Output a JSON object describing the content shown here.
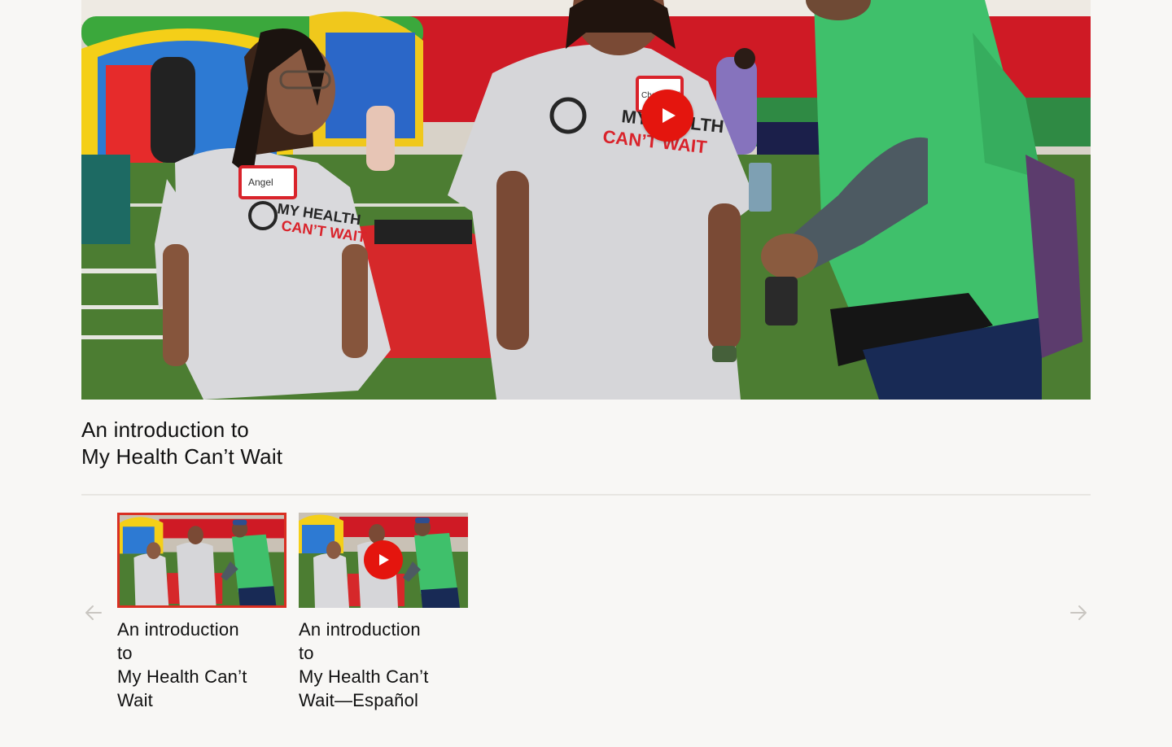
{
  "player": {
    "main_title": [
      "An introduction to",
      "My Health Can’t Wait"
    ],
    "scene": {
      "shirt_text": [
        "MY HEALTH",
        "CAN’T WAIT"
      ],
      "badge_text": [
        "Angel",
        "Chadwood"
      ]
    }
  },
  "carousel": {
    "prev_icon": "arrow-left-icon",
    "next_icon": "arrow-right-icon",
    "items": [
      {
        "title": [
          "An introduction",
          "to",
          "My Health Can’t",
          "Wait"
        ],
        "selected": true,
        "shows_play_button": false
      },
      {
        "title": [
          "An introduction",
          "to",
          "My Health Can’t",
          "Wait—Español"
        ],
        "selected": false,
        "shows_play_button": true
      }
    ]
  },
  "colors": {
    "background": "#f8f7f5",
    "accent_red": "#e4150e",
    "selected_border": "#d92f22",
    "divider": "#e8e6e2",
    "arrow": "#c9c6c1",
    "text": "#111111"
  }
}
